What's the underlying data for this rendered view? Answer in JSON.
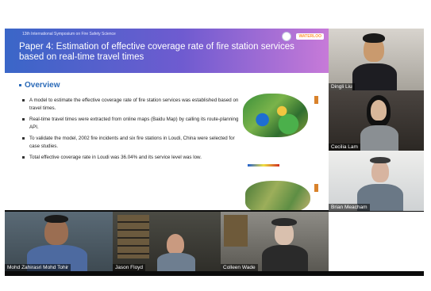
{
  "slide": {
    "conference": "13th International Symposium on Fire Safety Science",
    "logo_tag": "WATERLOO",
    "title_line1": "Paper 4: Estimation of effective coverage rate of fire station services",
    "title_line2": "based on real-time travel times",
    "section": "Overview",
    "bullets": [
      "A model to estimate the effective coverage rate of fire station services was established based on travel times.",
      "Real-time travel times were extracted from online maps (Baidu Map) by calling its route-planning API.",
      "To validate the model, 2002 fire incidents and six fire stations in Loudi, China were selected for case studies.",
      "Total effective coverage rate in Loudi was 36.04% and its service level was low."
    ]
  },
  "participants": [
    {
      "name": "Dingli Liu"
    },
    {
      "name": "Cecilia Lam"
    },
    {
      "name": "Brian Meacham"
    },
    {
      "name": "Mohd Zahirasri Mohd Tohir"
    },
    {
      "name": "Jason Floyd"
    },
    {
      "name": "Colleen Wade"
    }
  ]
}
